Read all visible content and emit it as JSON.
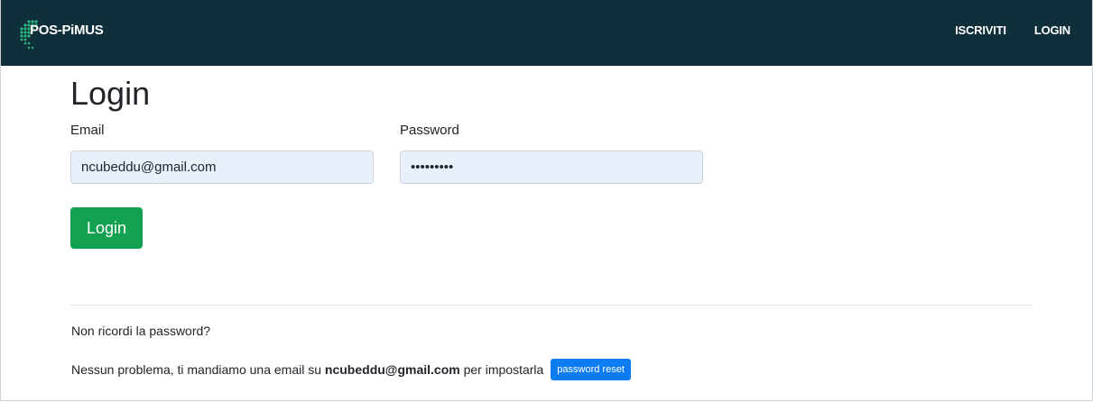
{
  "navbar": {
    "brand": "POS-PiMUS",
    "links": [
      "ISCRIVITI",
      "LOGIN"
    ]
  },
  "login": {
    "title": "Login",
    "email_label": "Email",
    "email_value": "ncubeddu@gmail.com",
    "password_label": "Password",
    "password_value": "*********",
    "submit_label": "Login"
  },
  "reset": {
    "question": "Non ricordi la password?",
    "text_before": "Nessun problema, ti mandiamo una email su",
    "email": "ncubeddu@gmail.com",
    "text_after": "per impostarla",
    "button_label": "password reset"
  },
  "colors": {
    "navbar_bg": "#0f2f3b",
    "logo_dots": "#2eb67d",
    "login_button": "#12a150",
    "reset_button": "#0d7cf2",
    "autofill_bg": "#e8f0fe"
  }
}
